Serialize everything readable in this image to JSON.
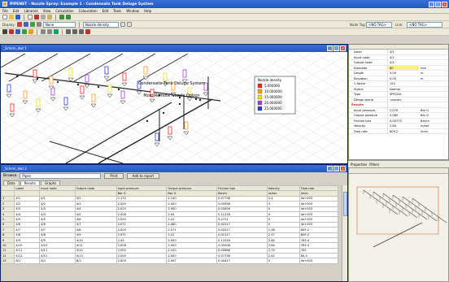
{
  "app": {
    "title": "PIPENET - Nozzle Spray: Example 1 - Condensate Tank Deluge System",
    "menu": [
      "File",
      "Edit",
      "Libraries",
      "View",
      "Calculation",
      "Colouration",
      "Edit",
      "Tools",
      "Window",
      "Help"
    ]
  },
  "toolbar": {
    "mode_label": "Display:",
    "mode_value": "None",
    "nozzle_label": "Nozzle density",
    "node_tag_label": "Node Tag:",
    "node_tag_value": "<NO TAG>",
    "link_label": "Link:",
    "link_tag_value": "<NO TAG>"
  },
  "drawing": {
    "window_title": "_Schem_dwt 1",
    "title_line1": "Condensate Tank Deluge System",
    "title_line2": "Most Remote Nozzle Option",
    "legend_title": "Nozzle density",
    "legend": [
      {
        "label": "5.000000",
        "color": "#ff2020"
      },
      {
        "label": "10.000000",
        "color": "#ff9a2a"
      },
      {
        "label": "15.000000",
        "color": "#e7e020"
      },
      {
        "label": "20.000000",
        "color": "#a040c8"
      },
      {
        "label": "25.000000",
        "color": "#2a40d0"
      }
    ]
  },
  "results": {
    "window_title": "_Schem_dwt 2",
    "field_label": "Browse",
    "field_value": "Pipes",
    "print_button": "Print",
    "add_report_button": "Add to report",
    "tabs": [
      "Data",
      "Results",
      "Graphs"
    ],
    "columns": [
      "",
      "Label",
      "Input node",
      "Output node",
      "Input pressure",
      "Output pressure",
      "Friction loss",
      "Velocity",
      "Flow rate"
    ],
    "units": [
      "",
      "",
      "",
      "",
      "Bar G",
      "Bar G",
      "Bar/m",
      "m/sec",
      "l/min"
    ],
    "rows": [
      [
        "1",
        "4/1",
        "4/1",
        "4/2",
        "2.170",
        "2.140",
        "0.07738",
        "2.4",
        "4e+003"
      ],
      [
        "2",
        "4/2",
        "4/2",
        "4/3",
        "2.000",
        "2.000",
        "0.05998",
        "3",
        "4e+003"
      ],
      [
        "3",
        "4/3",
        "4/3",
        "4/4",
        "2.020",
        "2.000",
        "0.03456",
        "0",
        "4e+003"
      ],
      [
        "4",
        "4/4",
        "4/4",
        "4/5",
        "2.008",
        "2.04",
        "0.11228",
        "0",
        "4e+003"
      ],
      [
        "5",
        "4/5",
        "4/5",
        "4/6",
        "2.020",
        "2.41",
        "0.2711",
        "0",
        "4e+003"
      ],
      [
        "6",
        "4/6",
        "4/6",
        "4/7",
        "2.071",
        "2.460",
        "0.02217",
        "0",
        "4e+003"
      ],
      [
        "7",
        "4/7",
        "4/7",
        "4/8",
        "2.000",
        "2.071",
        "0.02217",
        "2.38",
        "809.2"
      ],
      [
        "8",
        "4/8",
        "4/8",
        "4/9",
        "2.071",
        "2.41",
        "0.01217",
        "2.47",
        "809.2"
      ],
      [
        "9",
        "4/9",
        "4/9",
        "4/10",
        "2.43",
        "2.000",
        "0.11026",
        "2.64",
        "783.4"
      ],
      [
        "10",
        "4/10",
        "4/10",
        "4/11",
        "2.008",
        "2.000",
        "0.05008",
        "2.64",
        "783.4"
      ],
      [
        "11",
        "4/11",
        "4/11",
        "4/12",
        "2.000",
        "2.100",
        "0.05868",
        "2.74",
        "720"
      ],
      [
        "12",
        "4/12",
        "4/12",
        "4/13",
        "2.000",
        "2.000",
        "0.07736",
        "2.41",
        "80.4"
      ],
      [
        "13",
        "B/1",
        "B/1",
        "B/2",
        "2.000",
        "2.097",
        "0.00417",
        "0",
        "4e+003"
      ]
    ]
  },
  "properties": {
    "rows": [
      {
        "k": "Label",
        "v": "4/1",
        "u": ""
      },
      {
        "k": "Input node",
        "v": "4/1",
        "u": ""
      },
      {
        "k": "Output node",
        "v": "4/2",
        "u": ""
      },
      {
        "k": "Diameter",
        "v": "80",
        "u": "mm",
        "hl": true
      },
      {
        "k": "Length",
        "v": "3.00",
        "u": "m"
      },
      {
        "k": "Elevation",
        "v": "0.00",
        "u": "m"
      },
      {
        "k": "C-factor",
        "v": "120",
        "u": ""
      },
      {
        "k": "Status",
        "v": "Normal",
        "u": ""
      },
      {
        "k": "Type",
        "v": "SPECIAL",
        "u": ""
      },
      {
        "k": "Design group",
        "v": "<none>",
        "u": ""
      },
      {
        "k": "Results",
        "v": "",
        "u": "",
        "section": true
      },
      {
        "k": "Input pressure",
        "v": "2.070",
        "u": "Bar G"
      },
      {
        "k": "Output pressure",
        "v": "2.060",
        "u": "Bar G"
      },
      {
        "k": "Friction loss",
        "v": "0.00775",
        "u": "Bar/m"
      },
      {
        "k": "Velocity",
        "v": "2.80",
        "u": "m/sec"
      },
      {
        "k": "Flow rate",
        "v": "809.2",
        "u": "l/min"
      }
    ],
    "tabs": [
      "Properties",
      "Filters"
    ]
  },
  "colors": {
    "titlebar": "#2457c5",
    "pipe": "#222222",
    "selection": "#ffee88"
  }
}
